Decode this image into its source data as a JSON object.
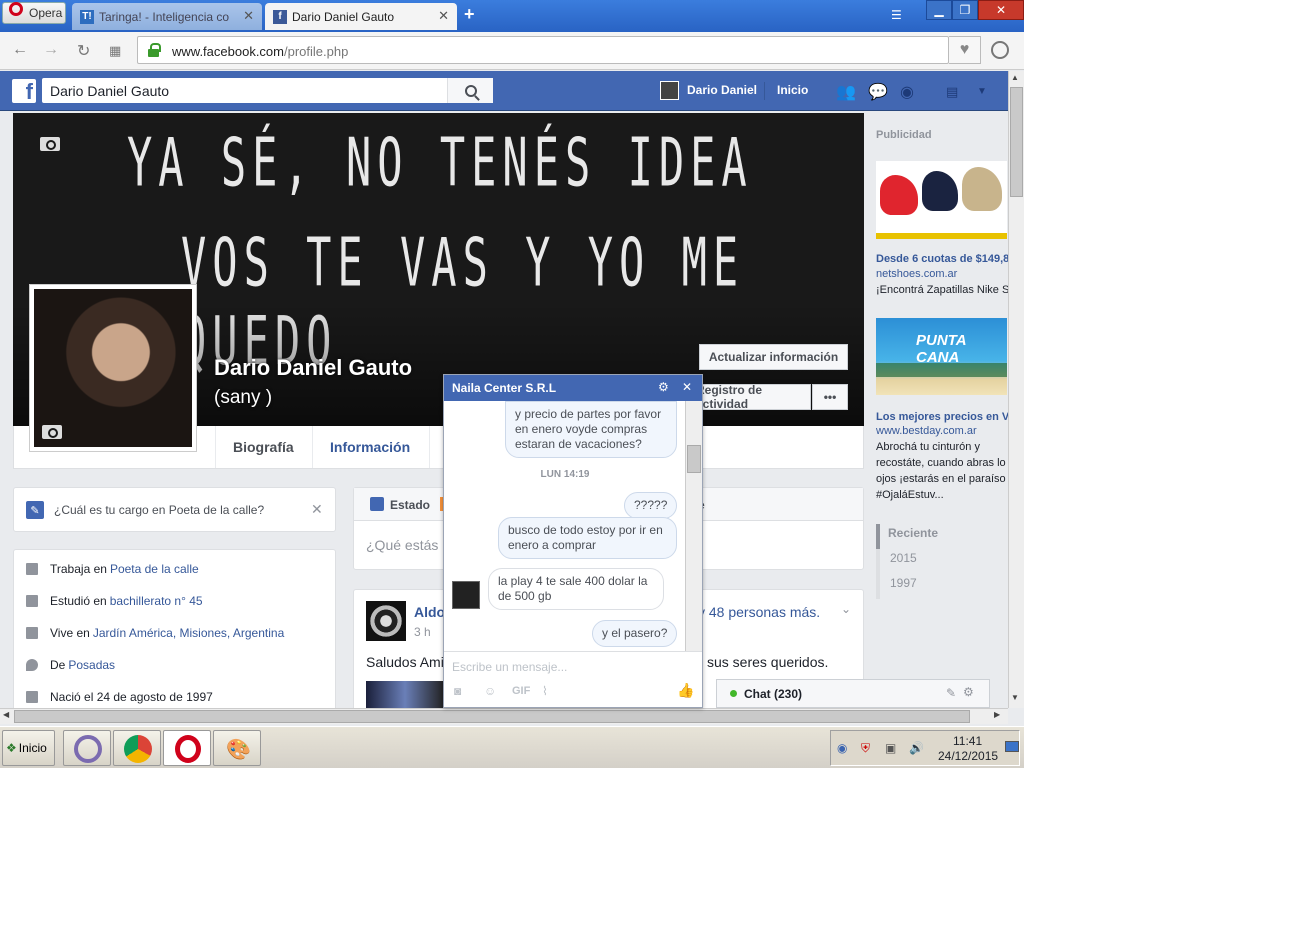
{
  "browser": {
    "menu_label": "Opera",
    "tabs": [
      {
        "label": "Taringa! - Inteligencia co",
        "favicon": "T!"
      },
      {
        "label": "Dario Daniel Gauto",
        "favicon": "f"
      }
    ],
    "url_host": "www.facebook.com",
    "url_path": "/profile.php"
  },
  "fb_header": {
    "search_value": "Dario Daniel Gauto",
    "user_name": "Dario Daniel",
    "home_label": "Inicio"
  },
  "cover": {
    "line1": "YA SÉ, NO TENÉS IDEA",
    "line2": "VOS TE VAS Y YO ME QUEDO"
  },
  "profile": {
    "name": "Dario Daniel Gauto",
    "nickname": "(sany )",
    "update_button": "Actualizar información",
    "activity_button": "Registro de actividad",
    "more_button": "•••",
    "tabs": [
      "Biografía",
      "Información"
    ]
  },
  "left": {
    "cargo_question": "¿Cuál es tu cargo en Poeta de la calle?",
    "info": [
      {
        "prefix": "Trabaja en",
        "link": "Poeta de la calle"
      },
      {
        "prefix": "Estudió en",
        "link": "bachillerato n° 45"
      },
      {
        "prefix": "Vive en",
        "link": "Jardín América, Misiones, Argentina"
      },
      {
        "prefix": "De",
        "link": "Posadas"
      },
      {
        "prefix": "Nació el 24 de agosto de 1997",
        "link": ""
      }
    ]
  },
  "composer": {
    "tab_estado": "Estado",
    "placeholder": "¿Qué estás"
  },
  "post": {
    "author": "Aldo",
    "tagged_suffix": "y 48 personas más.",
    "time": "3 h",
    "text_start": "Saludos Ami",
    "text_end": "sus seres queridos."
  },
  "ads": {
    "heading": "Publicidad",
    "ad1": {
      "title": "Desde 6 cuotas de $149,8",
      "url": "netshoes.com.ar",
      "text": "¡Encontrá Zapatillas Nike S"
    },
    "ad2": {
      "title": "Los mejores precios en V",
      "url": "www.bestday.com.ar",
      "text1": "Abrochá tu cinturón y",
      "text2": "recostáte, cuando abras lo",
      "text3": "ojos ¡estarás en el paraíso",
      "text4": "#OjaláEstuv...",
      "banner": "PUNTA CANA"
    },
    "years": [
      "Reciente",
      "2015",
      "1997"
    ]
  },
  "chat": {
    "title": "Naila Center S.R.L",
    "messages": {
      "m1": "y precio de partes por favor en enero voyde compras estaran de vacaciones?",
      "timestamp": "LUN 14:19",
      "m2": "?????",
      "m3": "busco de todo estoy por ir en enero a comprar",
      "m4": "la play 4 te sale 400 dolar la de 500 gb",
      "m5": "y el pasero?"
    },
    "input_placeholder": "Escribe un mensaje...",
    "bar_label": "Chat (230)"
  },
  "taskbar": {
    "start_label": "Inicio",
    "clock_time": "11:41",
    "clock_date": "24/12/2015"
  }
}
